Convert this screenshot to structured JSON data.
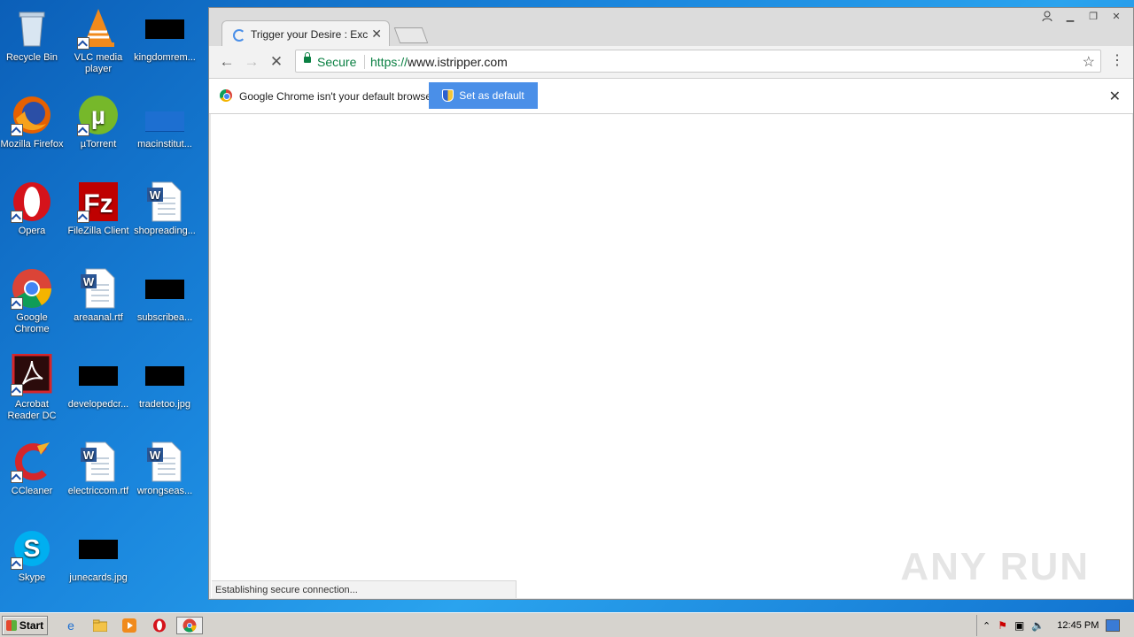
{
  "desktop": {
    "icons": [
      {
        "label": "Recycle Bin"
      },
      {
        "label": "VLC media player"
      },
      {
        "label": "kingdomrem..."
      },
      {
        "label": "Mozilla Firefox"
      },
      {
        "label": "µTorrent"
      },
      {
        "label": "macinstitut..."
      },
      {
        "label": "Opera"
      },
      {
        "label": "FileZilla Client"
      },
      {
        "label": "shopreading..."
      },
      {
        "label": "Google Chrome"
      },
      {
        "label": "areaanal.rtf"
      },
      {
        "label": "subscribea..."
      },
      {
        "label": "Acrobat Reader DC"
      },
      {
        "label": "developedcr..."
      },
      {
        "label": "tradetoo.jpg"
      },
      {
        "label": "CCleaner"
      },
      {
        "label": "electriccom.rtf"
      },
      {
        "label": "wrongseas..."
      },
      {
        "label": "Skype"
      },
      {
        "label": "junecards.jpg"
      }
    ]
  },
  "browser": {
    "tab_title": "Trigger your Desire : Exclus",
    "secure_label": "Secure",
    "url_scheme": "https://",
    "url_host": "www.istripper.com",
    "infobar_message": "Google Chrome isn't your default browser.",
    "set_default_label": "Set as default",
    "status_text": "Establishing secure connection..."
  },
  "watermark": "ANY RUN",
  "taskbar": {
    "start_label": "Start",
    "clock": "12:45 PM"
  }
}
